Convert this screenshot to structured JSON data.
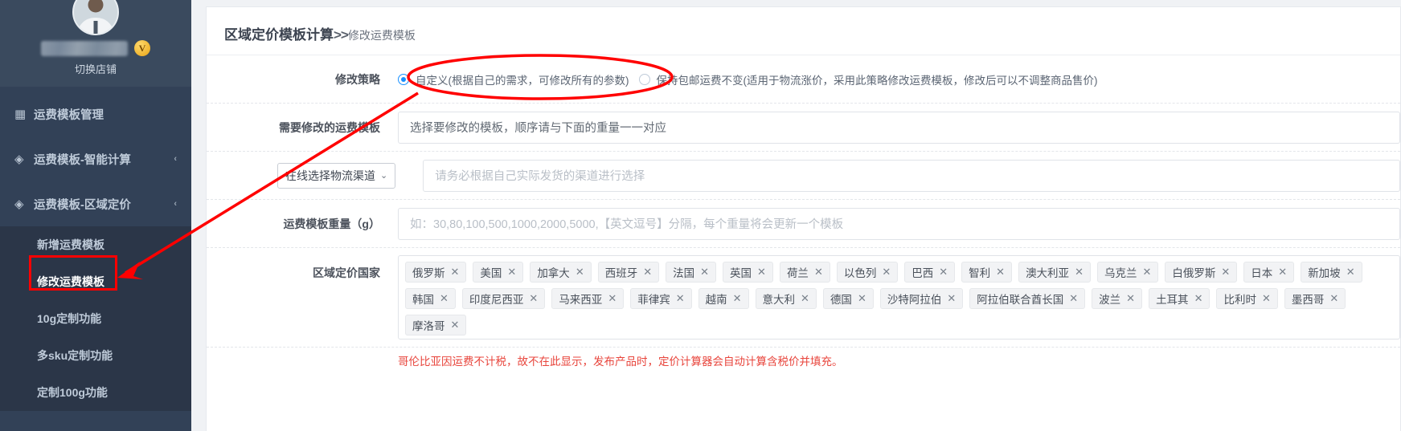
{
  "sidebar": {
    "profile": {
      "avatar_name": "user-avatar",
      "name_masked": "",
      "vip_badge": "V",
      "switch_shop": "切换店铺"
    },
    "menu": [
      {
        "icon": "grid-icon",
        "glyph": "▦",
        "label": "运费模板管理",
        "arrow": "",
        "name": "sidebar-item-template-manage"
      },
      {
        "icon": "diamond-icon",
        "glyph": "◈",
        "label": "运费模板-智能计算",
        "arrow": "‹",
        "name": "sidebar-item-smart-calc"
      },
      {
        "icon": "diamond-icon",
        "glyph": "◈",
        "label": "运费模板-区域定价",
        "arrow": "‹",
        "name": "sidebar-item-zone-pricing"
      }
    ],
    "sub_menu": [
      {
        "label": "新增运费模板",
        "current": false,
        "name": "sidebar-subitem-add-template"
      },
      {
        "label": "修改运费模板",
        "current": true,
        "name": "sidebar-subitem-edit-template"
      },
      {
        "label": "10g定制功能",
        "current": false,
        "name": "sidebar-subitem-10g"
      },
      {
        "label": "多sku定制功能",
        "current": false,
        "name": "sidebar-subitem-multi-sku"
      },
      {
        "label": "定制100g功能",
        "current": false,
        "name": "sidebar-subitem-100g"
      }
    ]
  },
  "breadcrumb": {
    "primary": "区域定价模板计算",
    "separator": ">>",
    "secondary": "修改运费模板"
  },
  "form": {
    "strategy": {
      "label": "修改策略",
      "options": [
        {
          "label": "自定义(根据自己的需求，可修改所有的参数)",
          "checked": true
        },
        {
          "label": "保持包邮运费不变(适用于物流涨价，采用此策略修改运费模板，修改后可以不调整商品售价)",
          "checked": false
        }
      ]
    },
    "template": {
      "label": "需要修改的运费模板",
      "placeholder": "选择要修改的模板，顺序请与下面的重量一一对应",
      "value": ""
    },
    "channel": {
      "select_label": "在线选择物流渠道",
      "caret": "⌄",
      "placeholder": "请务必根据自己实际发货的渠道进行选择",
      "value": ""
    },
    "weight": {
      "label": "运费模板重量（g）",
      "placeholder": "如：30,80,100,500,1000,2000,5000,【英文逗号】分隔，每个重量将会更新一个模板",
      "value": ""
    },
    "countries": {
      "label": "区域定价国家",
      "tags": [
        "俄罗斯",
        "美国",
        "加拿大",
        "西班牙",
        "法国",
        "英国",
        "荷兰",
        "以色列",
        "巴西",
        "智利",
        "澳大利亚",
        "乌克兰",
        "白俄罗斯",
        "日本",
        "新加坡",
        "韩国",
        "印度尼西亚",
        "马来西亚",
        "菲律宾",
        "越南",
        "意大利",
        "德国",
        "沙特阿拉伯",
        "阿拉伯联合酋长国",
        "波兰",
        "土耳其",
        "比利时",
        "墨西哥",
        "摩洛哥"
      ],
      "remove_glyph": "✕",
      "note": "哥伦比亚因运费不计税，故不在此显示，发布产品时，定价计算器会自动计算含税价并填充。"
    }
  },
  "annotations": {
    "ellipse_color": "#ff0000",
    "arrow_color": "#ff0000",
    "highlight_box_color": "#ff0000"
  }
}
